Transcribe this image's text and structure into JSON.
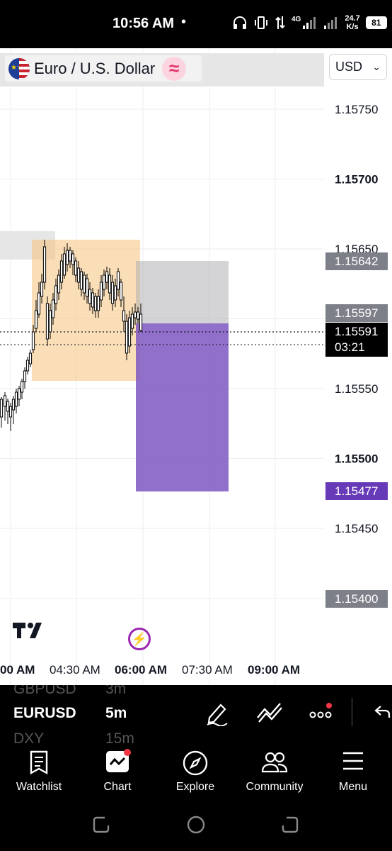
{
  "status_bar": {
    "time": "10:56 AM",
    "dot": "•",
    "network": "4G",
    "speed_value": "24.7",
    "speed_unit": "K/s",
    "battery": "81"
  },
  "header": {
    "symbol_name": "Euro / U.S. Dollar",
    "currency": "USD",
    "wave_symbol": "≈"
  },
  "price_axis": {
    "labels": [
      "1.15750",
      "1.15700",
      "1.15650",
      "1.15550",
      "1.15500",
      "1.15450"
    ],
    "bold_labels": [
      "1.15700",
      "1.15500"
    ]
  },
  "price_tags": {
    "position_top": "1.15642",
    "entry": "1.15597",
    "current_price": "1.15591",
    "countdown": "03:21",
    "target": "1.15477",
    "alert": "1.15400"
  },
  "time_axis": [
    "00 AM",
    "04:30 AM",
    "06:00 AM",
    "07:30 AM",
    "09:00 AM"
  ],
  "colors": {
    "zone": "#f6c37c",
    "target_box": "#7e57c2",
    "stop_box": "#a9a9ad",
    "candle": "#000000",
    "badge": "#f23645",
    "replay": "#9c27b0"
  },
  "symbol_strip": {
    "prev_symbol": "GBPUSD",
    "prev_tf": "3m",
    "symbol": "EURUSD",
    "timeframe": "5m",
    "next_symbol": "DXY",
    "next_tf": "15m"
  },
  "tools": [
    "pen-icon",
    "multiline-icon",
    "more-icon",
    "undo-icon"
  ],
  "nav": [
    {
      "label": "Watchlist",
      "icon": "watchlist-icon"
    },
    {
      "label": "Chart",
      "icon": "chart-icon"
    },
    {
      "label": "Explore",
      "icon": "compass-icon"
    },
    {
      "label": "Community",
      "icon": "community-icon"
    },
    {
      "label": "Menu",
      "icon": "menu-icon"
    }
  ]
}
